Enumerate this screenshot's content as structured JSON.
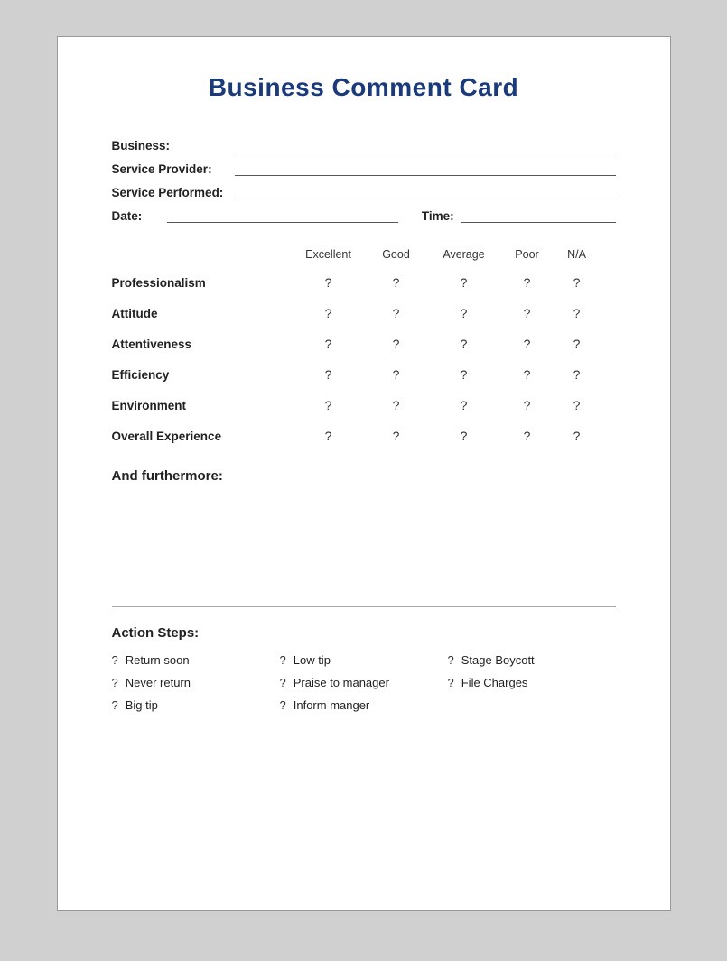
{
  "card": {
    "title": "Business Comment Card",
    "fields": {
      "business_label": "Business:",
      "service_provider_label": "Service Provider:",
      "service_performed_label": "Service Performed:",
      "date_label": "Date:",
      "time_label": "Time:"
    },
    "ratings": {
      "headers": [
        "",
        "Excellent",
        "Good",
        "Average",
        "Poor",
        "N/A"
      ],
      "rows": [
        {
          "label": "Professionalism",
          "values": [
            "?",
            "?",
            "?",
            "?",
            "?"
          ]
        },
        {
          "label": "Attitude",
          "values": [
            "?",
            "?",
            "?",
            "?",
            "?"
          ]
        },
        {
          "label": "Attentiveness",
          "values": [
            "?",
            "?",
            "?",
            "?",
            "?"
          ]
        },
        {
          "label": "Efficiency",
          "values": [
            "?",
            "?",
            "?",
            "?",
            "?"
          ]
        },
        {
          "label": "Environment",
          "values": [
            "?",
            "?",
            "?",
            "?",
            "?"
          ]
        },
        {
          "label": "Overall Experience",
          "values": [
            "?",
            "?",
            "?",
            "?",
            "?"
          ]
        }
      ]
    },
    "furthermore": {
      "title": "And furthermore:"
    },
    "action_steps": {
      "title": "Action Steps:",
      "items": [
        {
          "icon": "?",
          "text": "Return soon"
        },
        {
          "icon": "?",
          "text": "Low tip"
        },
        {
          "icon": "?",
          "text": "Stage Boycott"
        },
        {
          "icon": "?",
          "text": "Never return"
        },
        {
          "icon": "?",
          "text": "Praise to manager"
        },
        {
          "icon": "?",
          "text": "File Charges"
        },
        {
          "icon": "?",
          "text": "Big tip"
        },
        {
          "icon": "?",
          "text": "Inform manger"
        },
        {
          "icon": "",
          "text": ""
        }
      ]
    }
  }
}
